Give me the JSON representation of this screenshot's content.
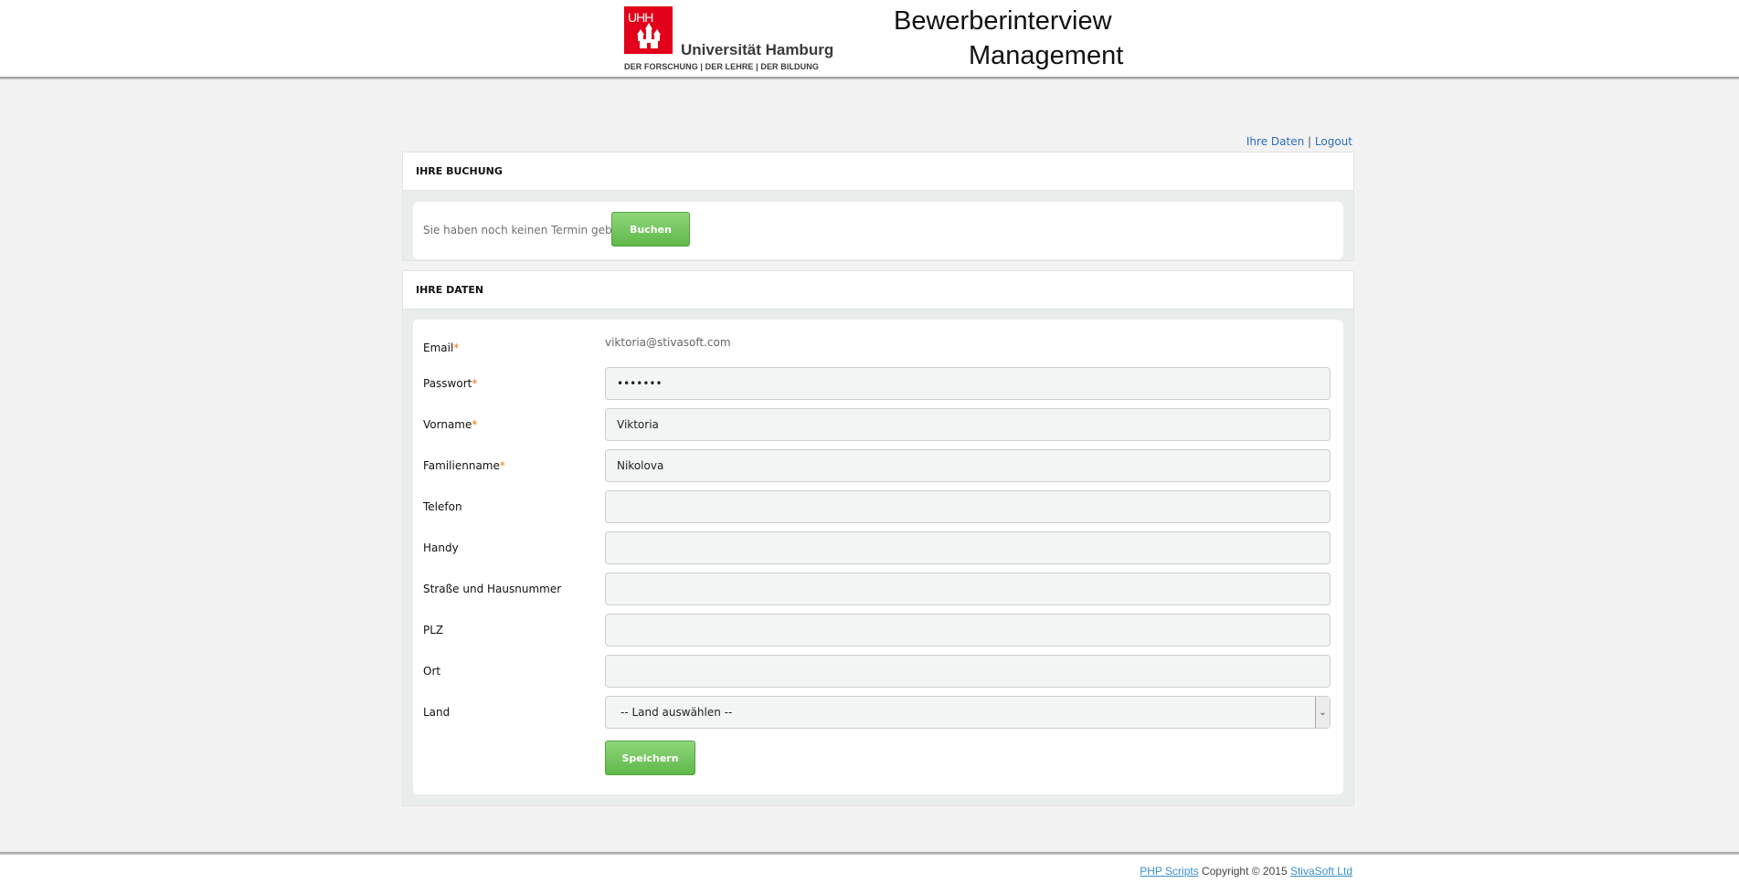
{
  "header": {
    "logo_box_text": "UHH",
    "logo_name": "Universität Hamburg",
    "logo_tagline": "DER FORSCHUNG | DER LEHRE | DER BILDUNG",
    "title_line1": "Bewerberinterview",
    "title_line2": "Management"
  },
  "toplinks": {
    "profile": "Ihre Daten",
    "separator": "|",
    "logout": "Logout"
  },
  "booking": {
    "heading": "IHRE BUCHUNG",
    "message": "Sie haben noch keinen Termin gebucht.",
    "button": "Buchen"
  },
  "profile": {
    "heading": "IHRE DATEN",
    "required_mark": "*",
    "fields": {
      "email": {
        "label": "Email",
        "value": "viktoria@stivasoft.com"
      },
      "password": {
        "label": "Passwort",
        "value": "*******"
      },
      "firstname": {
        "label": "Vorname",
        "value": "Viktoria"
      },
      "lastname": {
        "label": "Familienname",
        "value": "Nikolova"
      },
      "phone": {
        "label": "Telefon",
        "value": ""
      },
      "mobile": {
        "label": "Handy",
        "value": ""
      },
      "street": {
        "label": "Straße und Hausnummer",
        "value": ""
      },
      "zip": {
        "label": "PLZ",
        "value": ""
      },
      "city": {
        "label": "Ort",
        "value": ""
      },
      "country": {
        "label": "Land",
        "value": "-- Land auswählen --"
      }
    },
    "save_button": "Speichern"
  },
  "footer": {
    "link1": "PHP Scripts",
    "copyright": " Copyright © 2015 ",
    "link2": "StivaSoft Ltd"
  },
  "colors": {
    "accent_green": "#6bbf55",
    "brand_red": "#e2001a",
    "link_blue": "#2a6ebb"
  }
}
